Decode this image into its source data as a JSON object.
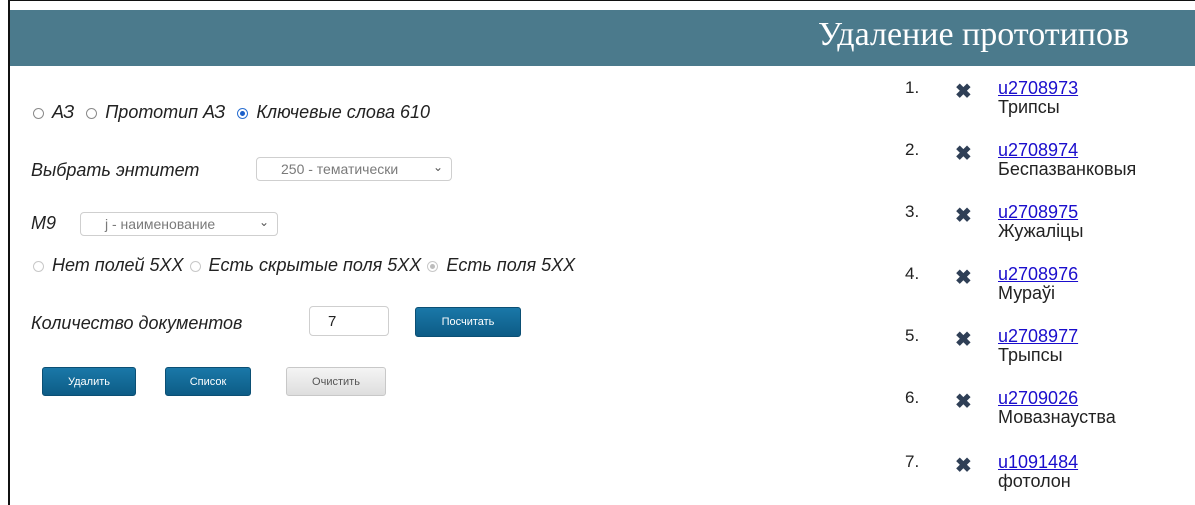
{
  "header": {
    "title": "Удаление прототипов",
    "color": "#4b7a8c"
  },
  "mode_options": [
    {
      "label": "АЗ",
      "checked": false
    },
    {
      "label": "Прототип АЗ",
      "checked": false
    },
    {
      "label": "Ключевые слова 610",
      "checked": true
    }
  ],
  "entity": {
    "label": "Выбрать энтитет",
    "selected": "250 - тематически"
  },
  "m9": {
    "label": "M9",
    "selected": "j - наименование"
  },
  "fields_options": [
    {
      "label": "Нет полей 5XX",
      "checked": false
    },
    {
      "label": "Есть скрытые поля 5XX",
      "checked": false
    },
    {
      "label": "Есть поля 5XX",
      "checked": true
    }
  ],
  "count": {
    "label": "Количество документов",
    "value": "7",
    "button": "Посчитать"
  },
  "actions": {
    "delete": "Удалить",
    "list": "Список",
    "clear": "Очистить"
  },
  "results": [
    {
      "num": "1.",
      "id": "u2708973",
      "name": "Трипсы"
    },
    {
      "num": "2.",
      "id": "u2708974",
      "name": "Беспазванковыя"
    },
    {
      "num": "3.",
      "id": "u2708975",
      "name": "Жужаліцы"
    },
    {
      "num": "4.",
      "id": "u2708976",
      "name": "Мураўі"
    },
    {
      "num": "5.",
      "id": "u2708977",
      "name": "Трыпсы"
    },
    {
      "num": "6.",
      "id": "u2709026",
      "name": "Мовазнауства"
    },
    {
      "num": "7.",
      "id": "u1091484",
      "name": "фотолон"
    }
  ],
  "icons": {
    "remove": "close-x-icon",
    "dropdown": "chevron-down-icon"
  }
}
